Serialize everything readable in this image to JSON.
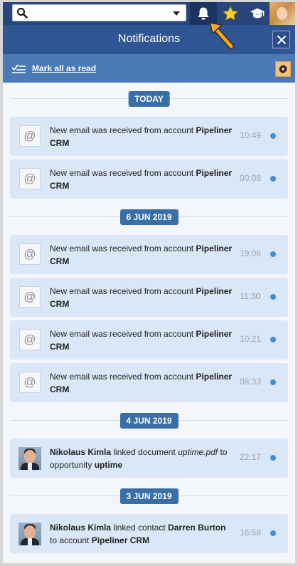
{
  "topbar": {
    "search_placeholder": "",
    "icons": [
      "search-icon",
      "dropdown-caret-icon",
      "bell-icon",
      "star-icon",
      "graduation-cap-icon",
      "user-avatar"
    ]
  },
  "header": {
    "title": "Notifications"
  },
  "actionbar": {
    "mark_all_label": "Mark all as read"
  },
  "colors": {
    "accent": "#28467a",
    "header": "#2f5592",
    "actionbar": "#4a79b5",
    "badge": "#3a6ea6",
    "card": "#d9e7f6",
    "unread_dot": "#3b8fdc",
    "arrow": "#f5a623"
  },
  "groups": [
    {
      "date": "TODAY",
      "items": [
        {
          "type": "email",
          "pre": "New email was received from account ",
          "bold": "Pipeliner CRM",
          "time": "10:49"
        },
        {
          "type": "email",
          "pre": "New email was received from account ",
          "bold": "Pipeliner CRM",
          "time": "00:08"
        }
      ]
    },
    {
      "date": "6 JUN 2019",
      "items": [
        {
          "type": "email",
          "pre": "New email was received from account ",
          "bold": "Pipeliner CRM",
          "time": "19:06"
        },
        {
          "type": "email",
          "pre": "New email was received from account ",
          "bold": "Pipeliner CRM",
          "time": "11:30"
        },
        {
          "type": "email",
          "pre": "New email was received from account ",
          "bold": "Pipeliner CRM",
          "time": "10:21"
        },
        {
          "type": "email",
          "pre": "New email was received from account ",
          "bold": "Pipeliner CRM",
          "time": "08:33"
        }
      ]
    },
    {
      "date": "4 JUN 2019",
      "items": [
        {
          "type": "user",
          "actor": "Nikolaus Kimla",
          "t1": " linked document ",
          "italic": "uptime.pdf",
          "t2": " to opportunity ",
          "bold": "uptime",
          "time": "22:17"
        }
      ]
    },
    {
      "date": "3 JUN 2019",
      "items": [
        {
          "type": "user",
          "actor": "Nikolaus Kimla",
          "t1": " linked contact ",
          "bold_contact": "Darren Burton",
          "t2": " to account ",
          "bold": "Pipeliner CRM",
          "time": "16:58"
        }
      ]
    }
  ]
}
